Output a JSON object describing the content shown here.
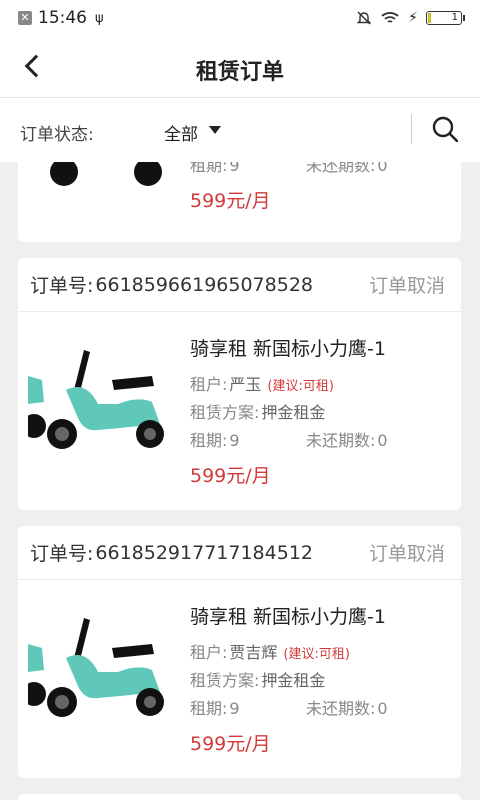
{
  "status_bar": {
    "time": "15:46",
    "battery": "1"
  },
  "nav": {
    "title": "租赁订单"
  },
  "filter": {
    "label": "订单状态:",
    "value": "全部"
  },
  "orders": [
    {
      "period_label": "租期:",
      "period": "9",
      "remaining_label": "未还期数:",
      "remaining": "0",
      "price": "599元/月"
    },
    {
      "order_label": "订单号:",
      "order_no": "661859661965078528",
      "status": "订单取消",
      "name": "骑享租 新国标小力鹰-1",
      "tenant_label": "租户:",
      "tenant": "严玉",
      "suggestion": "(建议:可租)",
      "plan_label": "租赁方案:",
      "plan": "押金租金",
      "period_label": "租期:",
      "period": "9",
      "remaining_label": "未还期数:",
      "remaining": "0",
      "price": "599元/月"
    },
    {
      "order_label": "订单号:",
      "order_no": "661852917717184512",
      "status": "订单取消",
      "name": "骑享租 新国标小力鹰-1",
      "tenant_label": "租户:",
      "tenant": "贾吉辉",
      "suggestion": "(建议:可租)",
      "plan_label": "租赁方案:",
      "plan": "押金租金",
      "period_label": "租期:",
      "period": "9",
      "remaining_label": "未还期数:",
      "remaining": "0",
      "price": "599元/月"
    }
  ],
  "colors": {
    "price": "#d23a3a",
    "scooter": "#5fc8b8",
    "background": "#efefef"
  }
}
